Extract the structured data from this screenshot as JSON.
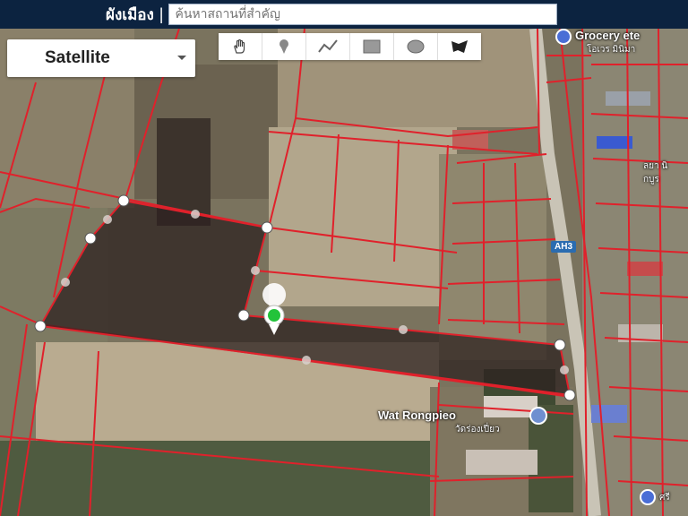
{
  "header": {
    "title": "ผังเมือง",
    "separator": "|",
    "search_placeholder": "ค้นหาสถานที่สำคัญ"
  },
  "map_type": {
    "selected": "Satellite"
  },
  "drawing_tools": [
    {
      "name": "hand-icon"
    },
    {
      "name": "marker-icon"
    },
    {
      "name": "polyline-icon"
    },
    {
      "name": "rectangle-icon"
    },
    {
      "name": "circle-icon"
    },
    {
      "name": "polygon-icon"
    }
  ],
  "labels": {
    "grocery": "Grocery ete",
    "grocery_sub": "โอเวร มินิมา",
    "highway": "AH3",
    "temple": "Wat Rongpieo",
    "temple_sub": "วัดร่องเปี่ยว",
    "town_sub": "ลยา นิกบูร",
    "bottom_right": "ศรี"
  },
  "colors": {
    "header_bg": "#0c2340",
    "parcel_line": "#e0212b",
    "selection_fill": "#3a2a2a"
  }
}
